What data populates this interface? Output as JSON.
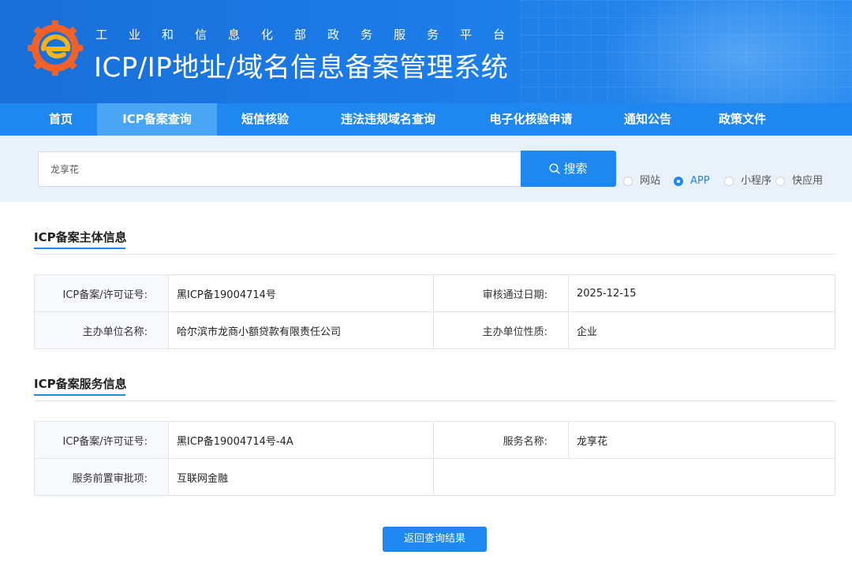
{
  "header": {
    "subtitle": "工业和信息化部政务服务平台",
    "title": "ICP/IP地址/域名信息备案管理系统"
  },
  "nav": {
    "items": [
      {
        "label": "首页"
      },
      {
        "label": "ICP备案查询"
      },
      {
        "label": "短信核验"
      },
      {
        "label": "违法违规域名查询"
      },
      {
        "label": "电子化核验申请"
      },
      {
        "label": "通知公告"
      },
      {
        "label": "政策文件"
      }
    ],
    "active_index": 1
  },
  "search": {
    "value": "龙享花",
    "button_label": "搜索",
    "options": [
      {
        "label": "网站",
        "checked": false
      },
      {
        "label": "APP",
        "checked": true
      },
      {
        "label": "小程序",
        "checked": false
      },
      {
        "label": "快应用",
        "checked": false
      }
    ]
  },
  "subject_info": {
    "title": "ICP备案主体信息",
    "rows": [
      {
        "k1": "ICP备案/许可证号:",
        "v1": "黑ICP备19004714号",
        "k2": "审核通过日期:",
        "v2": "2025-12-15"
      },
      {
        "k1": "主办单位名称:",
        "v1": "哈尔滨市龙商小额贷款有限责任公司",
        "k2": "主办单位性质:",
        "v2": "企业"
      }
    ]
  },
  "service_info": {
    "title": "ICP备案服务信息",
    "rows": [
      {
        "k1": "ICP备案/许可证号:",
        "v1": "黑ICP备19004714号-4A",
        "k2": "服务名称:",
        "v2": "龙享花"
      },
      {
        "k1": "服务前置审批项:",
        "v1": "互联网金融",
        "k2": "",
        "v2": ""
      }
    ]
  },
  "back_button_label": "返回查询结果",
  "colors": {
    "primary": "#1e88f0",
    "nav_active": "#4aa6f5",
    "search_bg": "#e9f2fb"
  }
}
